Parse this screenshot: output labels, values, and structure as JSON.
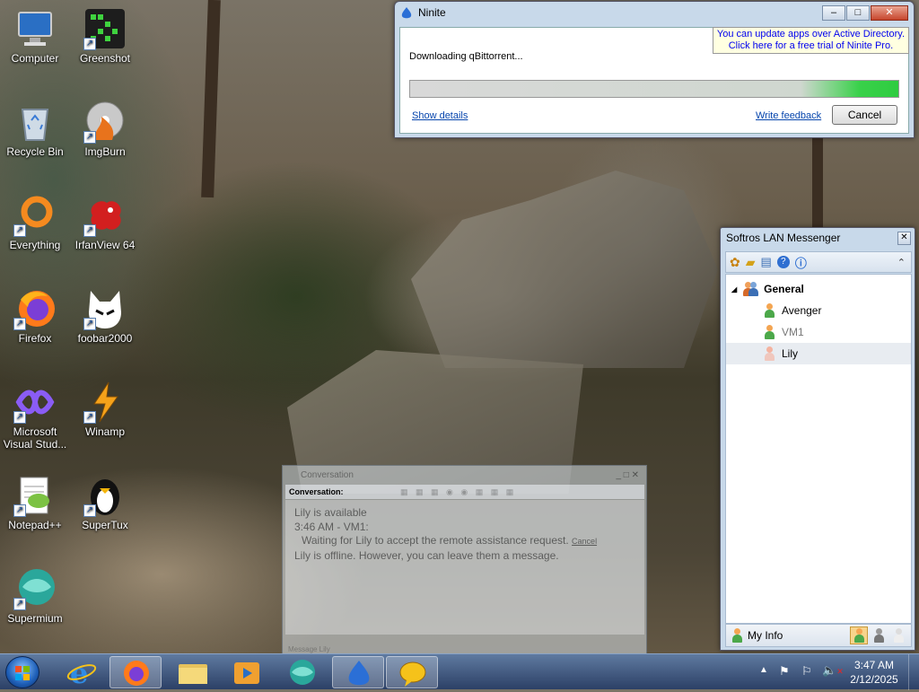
{
  "desktop": {
    "icons": [
      {
        "label": "Computer",
        "icon": "computer-icon",
        "shortcut": false
      },
      {
        "label": "Greenshot",
        "icon": "greenshot-icon",
        "shortcut": true
      },
      {
        "label": "Recycle Bin",
        "icon": "recycle-bin-icon",
        "shortcut": false
      },
      {
        "label": "ImgBurn",
        "icon": "imgburn-icon",
        "shortcut": true
      },
      {
        "label": "Everything",
        "icon": "everything-icon",
        "shortcut": true
      },
      {
        "label": "IrfanView 64",
        "icon": "irfanview-icon",
        "shortcut": true
      },
      {
        "label": "Firefox",
        "icon": "firefox-icon",
        "shortcut": true
      },
      {
        "label": "foobar2000",
        "icon": "foobar2000-icon",
        "shortcut": true
      },
      {
        "label": "Microsoft Visual Stud...",
        "icon": "visual-studio-icon",
        "shortcut": true
      },
      {
        "label": "Winamp",
        "icon": "winamp-icon",
        "shortcut": true
      },
      {
        "label": "Notepad++",
        "icon": "notepadpp-icon",
        "shortcut": true
      },
      {
        "label": "SuperTux",
        "icon": "supertux-icon",
        "shortcut": true
      },
      {
        "label": "Supermium",
        "icon": "supermium-icon",
        "shortcut": true
      }
    ]
  },
  "ninite": {
    "title": "Ninite",
    "promo_line1": "You can update apps over Active Directory.",
    "promo_line2": "Click here for a free trial of Ninite Pro.",
    "status": "Downloading qBittorrent...",
    "progress": 1.0,
    "show_details": "Show details",
    "write_feedback": "Write feedback",
    "cancel": "Cancel"
  },
  "messenger": {
    "title": "Softros LAN Messenger",
    "group": "General",
    "contacts": [
      {
        "name": "Avenger",
        "status": "online"
      },
      {
        "name": "VM1",
        "status": "online-dim"
      },
      {
        "name": "Lily",
        "status": "offline"
      }
    ],
    "my_info": "My Info"
  },
  "conversation": {
    "title": "Conversation",
    "header": "Conversation:",
    "lines": [
      "Lily is available",
      "3:46 AM - VM1:",
      "Waiting for Lily to accept the remote assistance request.",
      "Lily is offline. However, you can leave them a message."
    ],
    "cancel_link": "Cancel",
    "footer": "Message Lily"
  },
  "taskbar": {
    "items": [
      "start-orb",
      "internet-explorer-icon",
      "firefox-icon",
      "file-explorer-icon",
      "media-player-icon",
      "supermium-icon",
      "ninite-icon",
      "softros-messenger-icon"
    ],
    "time": "3:47 AM",
    "date": "2/12/2025"
  },
  "colors": {
    "progress": "#2ecc40",
    "taskbar": "#3b5078",
    "link": "#0645ad"
  }
}
